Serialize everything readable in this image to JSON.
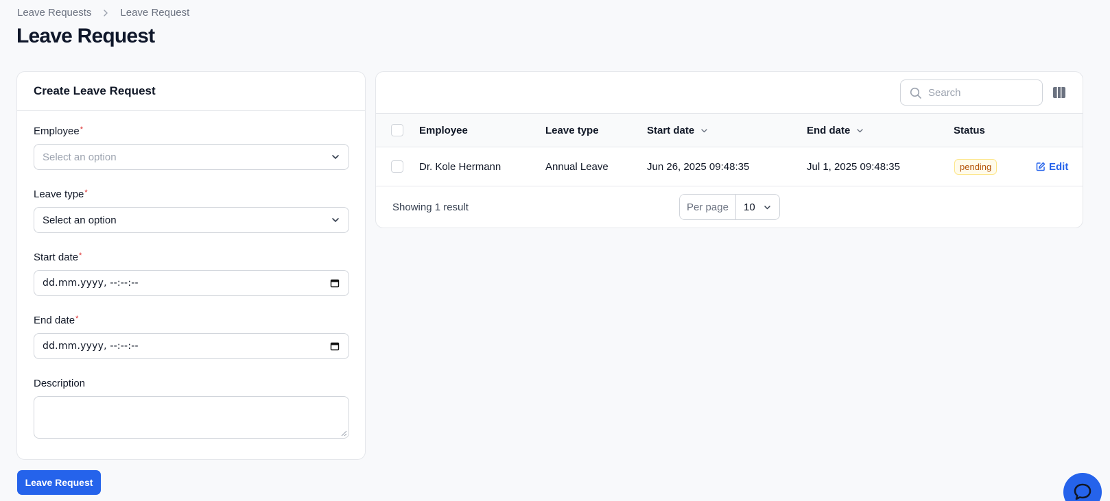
{
  "breadcrumb": {
    "items": [
      "Leave Requests",
      "Leave Request"
    ]
  },
  "page": {
    "title": "Leave Request"
  },
  "form": {
    "title": "Create Leave Request",
    "fields": {
      "employee": {
        "label": "Employee",
        "required_mark": "*",
        "value": "",
        "placeholder": "Select an option"
      },
      "leave_type": {
        "label": "Leave type",
        "required_mark": "*",
        "value": "Select an option"
      },
      "start_date": {
        "label": "Start date",
        "required_mark": "*",
        "value": "dd.mm.yyyy, --:--:--"
      },
      "end_date": {
        "label": "End date",
        "required_mark": "*",
        "value": "dd.mm.yyyy, --:--:--"
      },
      "description": {
        "label": "Description",
        "value": ""
      }
    },
    "submit_label": "Leave Request"
  },
  "table": {
    "search_placeholder": "Search",
    "columns": [
      "Employee",
      "Leave type",
      "Start date",
      "End date",
      "Status"
    ],
    "rows": [
      {
        "employee": "Dr. Kole Hermann",
        "leave_type": "Annual Leave",
        "start_date": "Jun 26, 2025 09:48:35",
        "end_date": "Jul 1, 2025 09:48:35",
        "status": "pending",
        "action": "Edit"
      }
    ],
    "footer": {
      "showing": "Showing 1 result",
      "per_page_label": "Per page",
      "per_page_value": "10"
    }
  },
  "colors": {
    "accent": "#2563eb",
    "pending_badge_bg": "#fffbeb",
    "pending_badge_text": "#b45309",
    "required": "#dc2626"
  },
  "icons": [
    "chevron-right-icon",
    "chevron-down-icon",
    "calendar-icon",
    "search-icon",
    "columns-icon",
    "sort-chevron-icon",
    "edit-icon",
    "chat-icon"
  ]
}
